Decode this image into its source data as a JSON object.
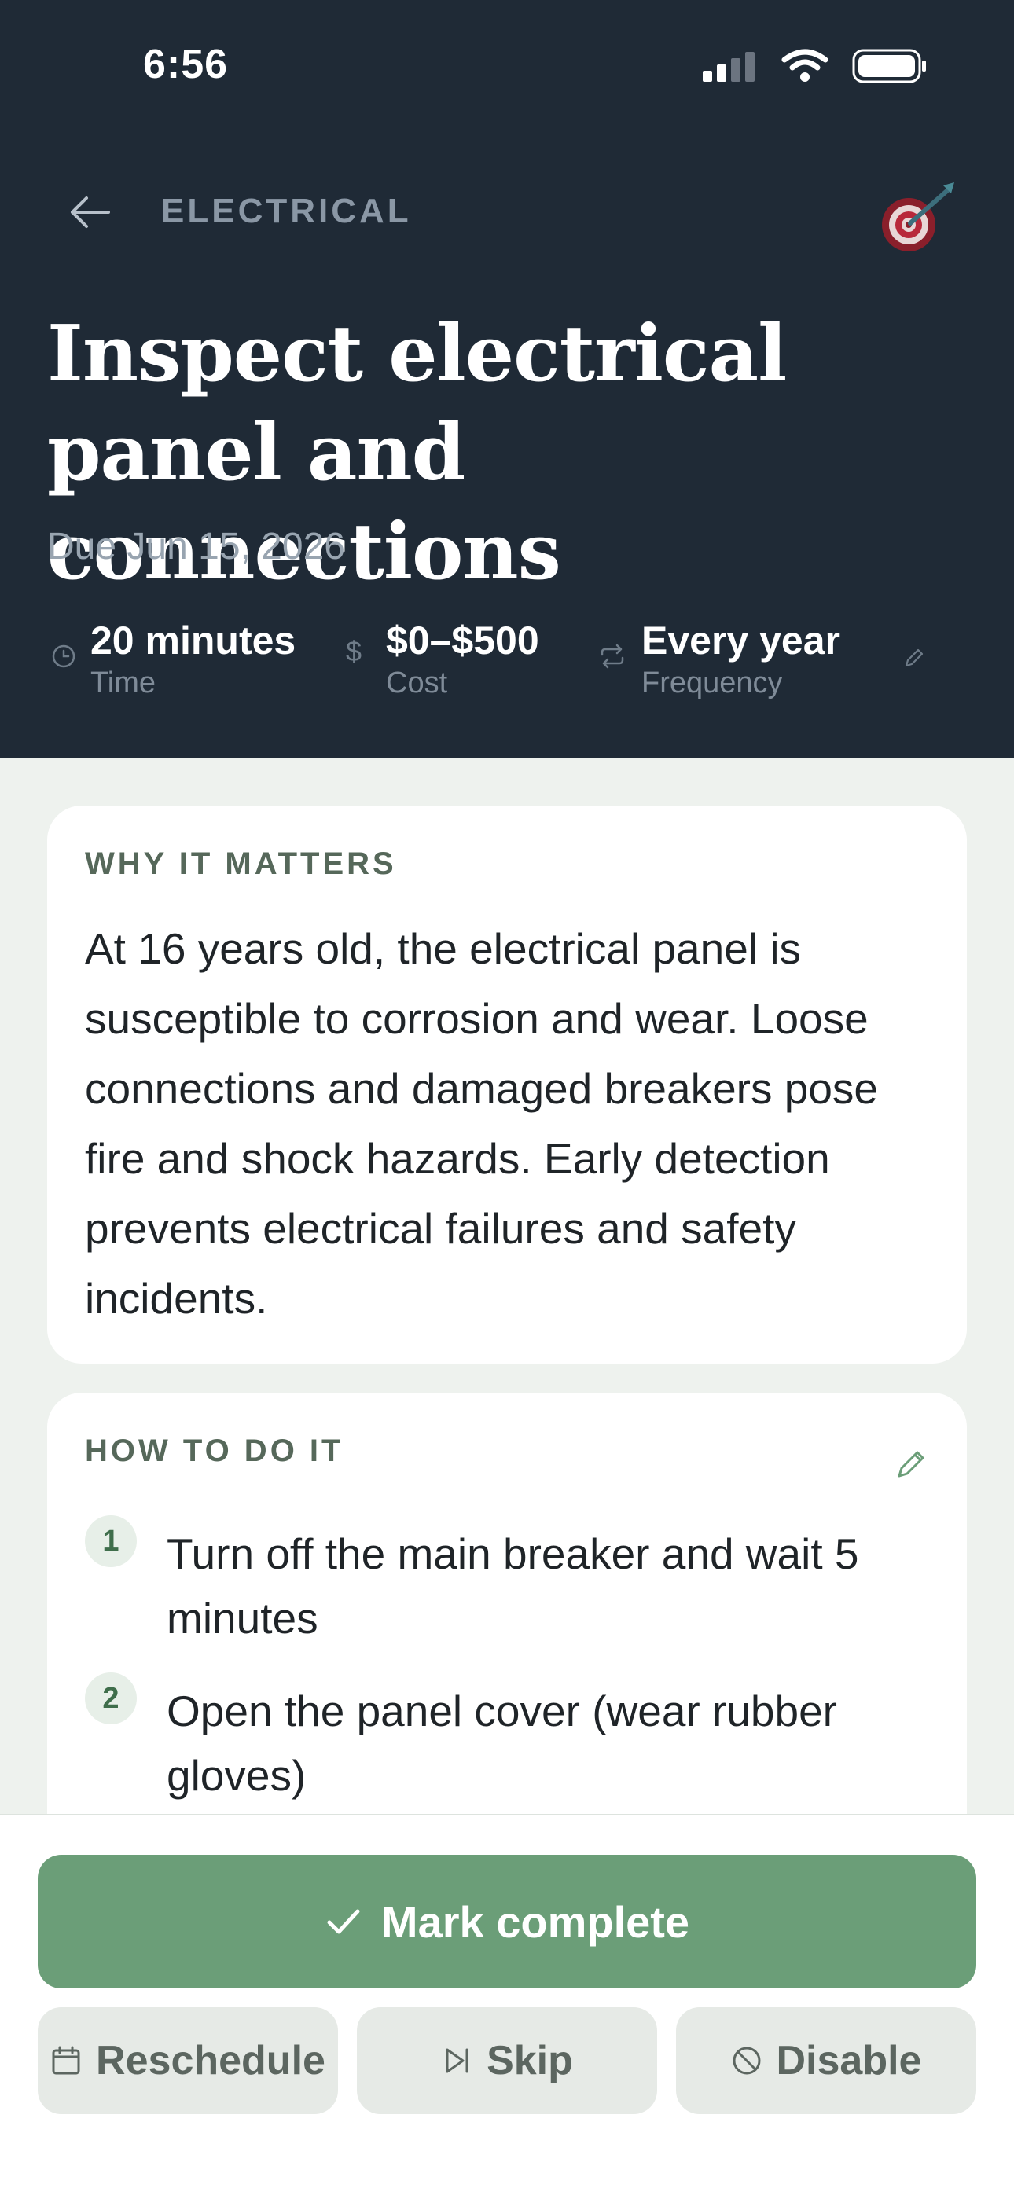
{
  "status_bar": {
    "time": "6:56"
  },
  "nav": {
    "category": "ELECTRICAL"
  },
  "task": {
    "title": "Inspect electrical panel and connections",
    "due": "Due Jun 15, 2026"
  },
  "meta": {
    "time": {
      "value": "20 minutes",
      "label": "Time"
    },
    "cost": {
      "value": "$0–$500",
      "label": "Cost"
    },
    "frequency": {
      "value": "Every year",
      "label": "Frequency"
    }
  },
  "why": {
    "heading": "WHY IT MATTERS",
    "text": "At 16 years old, the electrical panel is susceptible to corrosion and wear. Loose connections and damaged breakers pose fire and shock hazards. Early detection prevents electrical failures and safety incidents."
  },
  "how": {
    "heading": "HOW TO DO IT",
    "steps": [
      {
        "num": "1",
        "text": "Turn off the main breaker and wait 5 minutes"
      },
      {
        "num": "2",
        "text": "Open the panel cover (wear rubber gloves)"
      }
    ]
  },
  "actions": {
    "primary": "Mark complete",
    "reschedule": "Reschedule",
    "skip": "Skip",
    "disable": "Disable"
  },
  "colors": {
    "header_bg": "#1f2a36",
    "accent_green": "#6b9e78",
    "page_bg": "#eef2ee"
  },
  "icons": [
    "back-arrow-icon",
    "target-icon",
    "clock-icon",
    "dollar-icon",
    "repeat-icon",
    "pencil-icon",
    "check-icon",
    "calendar-icon",
    "skip-icon",
    "disable-icon"
  ]
}
